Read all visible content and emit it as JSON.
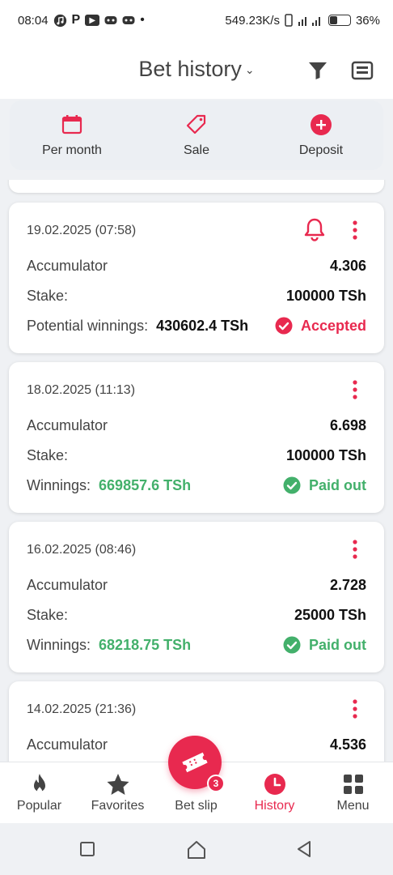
{
  "status_bar": {
    "time": "08:04",
    "app_icons": [
      "music-icon",
      "p-icon",
      "youtube-icon",
      "gamepad-icon",
      "gamepad-icon"
    ],
    "net_speed": "549.23K/s",
    "battery": "36%",
    "battery_level": 0.36
  },
  "header": {
    "title": "Bet history"
  },
  "quick_actions": [
    {
      "label": "Per month",
      "icon": "calendar-icon"
    },
    {
      "label": "Sale",
      "icon": "tag-icon"
    },
    {
      "label": "Deposit",
      "icon": "plus-circle-icon"
    }
  ],
  "bets": [
    {
      "date": "19.02.2025 (07:58)",
      "type": "Accumulator",
      "odds": "4.306",
      "stake_label": "Stake:",
      "stake": "100000 TSh",
      "win_label": "Potential winnings:",
      "win_amount": "430602.4 TSh",
      "status": "Accepted",
      "has_bell": true
    },
    {
      "date": "18.02.2025 (11:13)",
      "type": "Accumulator",
      "odds": "6.698",
      "stake_label": "Stake:",
      "stake": "100000 TSh",
      "win_label": "Winnings:",
      "win_amount": "669857.6 TSh",
      "status": "Paid out",
      "has_bell": false
    },
    {
      "date": "16.02.2025 (08:46)",
      "type": "Accumulator",
      "odds": "2.728",
      "stake_label": "Stake:",
      "stake": "25000 TSh",
      "win_label": "Winnings:",
      "win_amount": "68218.75 TSh",
      "status": "Paid out",
      "has_bell": false
    },
    {
      "date": "14.02.2025 (21:36)",
      "type": "Accumulator",
      "odds": "4.536"
    }
  ],
  "bottom_nav": [
    {
      "label": "Popular",
      "icon": "fire-icon"
    },
    {
      "label": "Favorites",
      "icon": "star-icon"
    },
    {
      "label": "Bet slip",
      "icon": "ticket-icon",
      "badge": "3"
    },
    {
      "label": "History",
      "icon": "clock-icon",
      "active": true
    },
    {
      "label": "Menu",
      "icon": "grid-icon"
    }
  ],
  "colors": {
    "accent": "#e8294f",
    "success": "#43b06b",
    "background": "#eff1f4"
  }
}
